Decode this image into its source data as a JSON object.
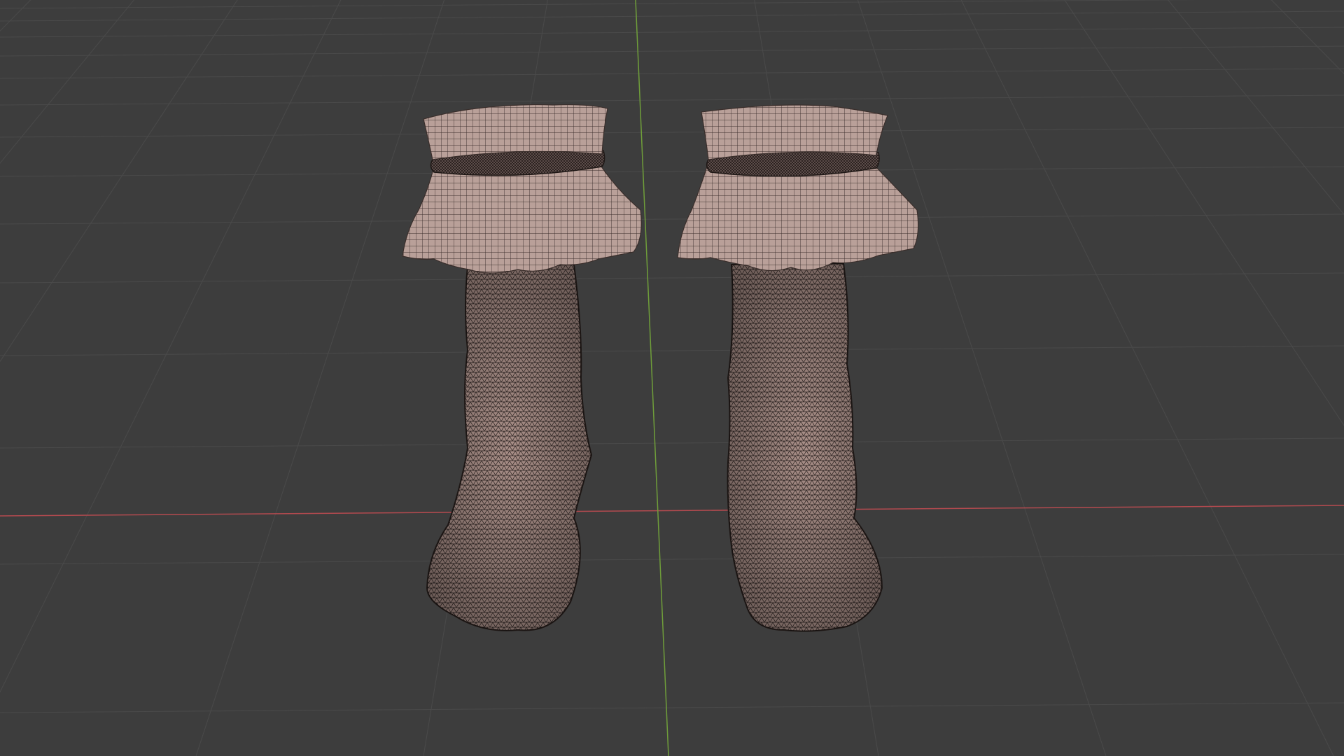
{
  "viewport": {
    "background": "#3d3d3d",
    "grid_color": "#4a4a4a",
    "x_axis_color": "#b34a4f",
    "y_axis_color": "#6f9e3a"
  },
  "scene": {
    "objects": [
      {
        "name": "left-sock",
        "mesh_color": "#b39890",
        "wire_color": "#2a2220",
        "display": "wireframe-overlay"
      },
      {
        "name": "right-sock",
        "mesh_color": "#b39890",
        "wire_color": "#2a2220",
        "display": "wireframe-overlay"
      }
    ]
  }
}
